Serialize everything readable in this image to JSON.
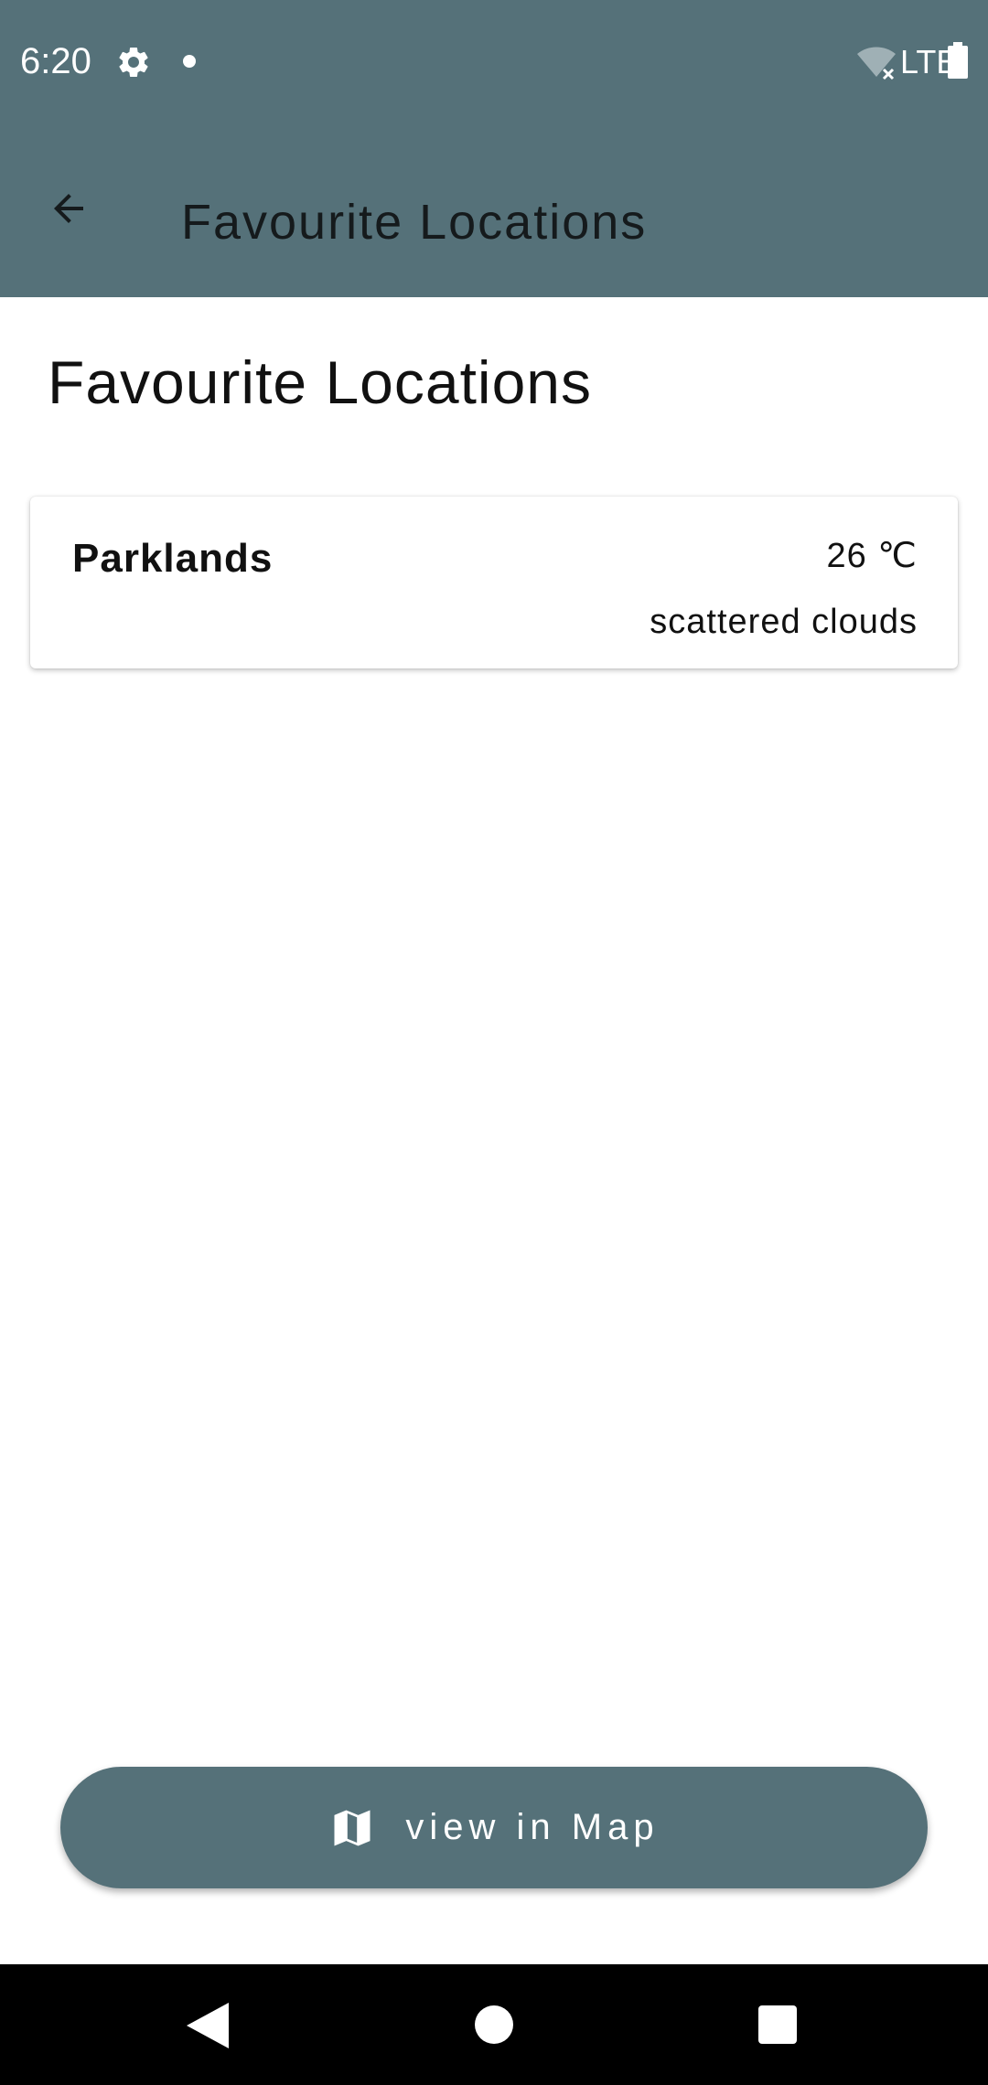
{
  "status_bar": {
    "time": "6:20",
    "network": "LTE",
    "icons": [
      "settings-gear-icon",
      "notification-dot-icon",
      "wifi-off-icon",
      "battery-icon"
    ]
  },
  "toolbar": {
    "title": "Favourite Locations",
    "back_icon": "arrow-left-icon"
  },
  "page": {
    "heading": "Favourite Locations"
  },
  "locations": [
    {
      "name": "Parklands",
      "temperature": "26 ℃",
      "description": "scattered clouds"
    }
  ],
  "map_button": {
    "label": "view in Map",
    "icon": "map-icon"
  },
  "nav_bar": {
    "icons": [
      "back-triangle-icon",
      "home-circle-icon",
      "recents-square-icon"
    ]
  },
  "colors": {
    "primary": "#557179",
    "background": "#ffffff",
    "nav_background": "#000000"
  }
}
